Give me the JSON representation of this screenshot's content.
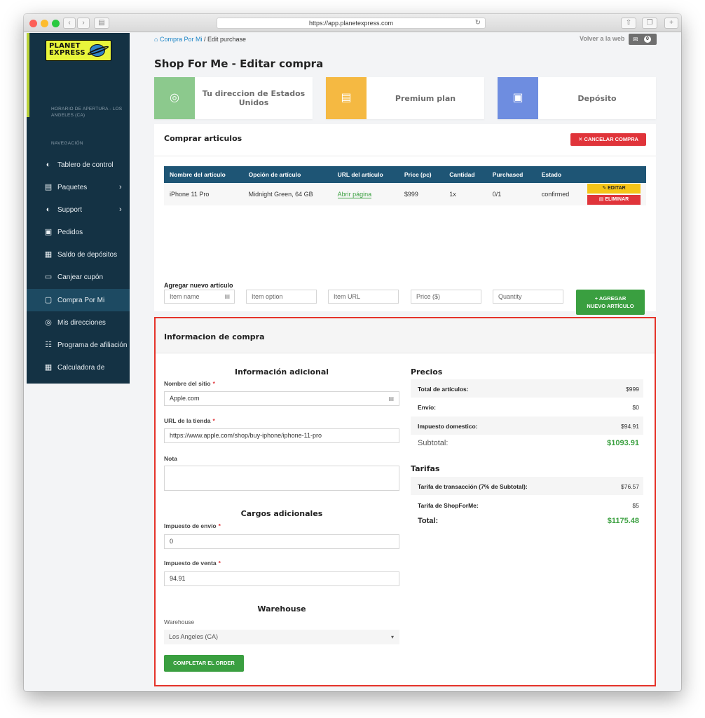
{
  "browser": {
    "url": "https://app.planetexpress.com",
    "reload_icon": "reload-icon"
  },
  "sidebar": {
    "logo_text_1": "PLANET",
    "logo_text_2": "EXPRESS",
    "hours": "HORARIO DE APERTURA - LOS ANGELES (CA)",
    "nav_title": "NAVEGACIÓN",
    "items": [
      {
        "label": "Tablero de control",
        "icon": "gauge-icon",
        "glyph": "◐",
        "chevron": ""
      },
      {
        "label": "Paquetes",
        "icon": "package-icon",
        "glyph": "▤",
        "chevron": "›"
      },
      {
        "label": "Support",
        "icon": "support-icon",
        "glyph": "◐",
        "chevron": "›"
      },
      {
        "label": "Pedidos",
        "icon": "orders-icon",
        "glyph": "▣",
        "chevron": ""
      },
      {
        "label": "Saldo de depósitos",
        "icon": "deposit-icon",
        "glyph": "▦",
        "chevron": ""
      },
      {
        "label": "Canjear cupón",
        "icon": "coupon-icon",
        "glyph": "▭",
        "chevron": ""
      },
      {
        "label": "Compra Por Mi",
        "icon": "shopping-bag-icon",
        "glyph": "▢",
        "chevron": ""
      },
      {
        "label": "Mis direcciones",
        "icon": "location-pin-icon",
        "glyph": "◎",
        "chevron": ""
      },
      {
        "label": "Programa de afiliación",
        "icon": "affiliate-icon",
        "glyph": "☷",
        "chevron": ""
      },
      {
        "label": "Calculadora de",
        "icon": "calculator-icon",
        "glyph": "▦",
        "chevron": ""
      }
    ]
  },
  "header": {
    "breadcrumb_home_icon": "home-icon",
    "breadcrumb_link": "Compra Por Mi",
    "breadcrumb_sep": "/",
    "breadcrumb_current": "Edit purchase",
    "volver": "Volver a la web",
    "notification_count": "0"
  },
  "page_title": "Shop For Me - Editar compra",
  "info_cards": [
    {
      "text": "Tu direccion de Estados Unidos",
      "icon": "location-pin-icon",
      "color": "#8cc98d"
    },
    {
      "text": "Premium plan",
      "icon": "clipboard-icon",
      "color": "#f5b942"
    },
    {
      "text": "Depósito",
      "icon": "dollar-box-icon",
      "color": "#6e8de0"
    }
  ],
  "articles": {
    "title": "Comprar articulos",
    "cancel_button": "CANCELAR COMPRA",
    "columns": [
      "Nombre del artículo",
      "Opción de artículo",
      "URL del artículo",
      "Price (pc)",
      "Cantidad",
      "Purchased",
      "Estado",
      ""
    ],
    "rows": [
      {
        "name": "iPhone 11 Pro",
        "option": "Midnight Green, 64 GB",
        "url": "Abrir página",
        "price": "$999",
        "quantity": "1x",
        "purchased": "0/1",
        "status": "confirmed",
        "edit": "EDITAR",
        "delete": "ELIMINAR"
      }
    ],
    "add_label": "Agregar nuevo artículo",
    "add_placeholders": {
      "name": "Item name",
      "option": "Item option",
      "url": "Item URL",
      "price": "Price ($)",
      "quantity": "Quantity"
    },
    "add_button_line1": "+ AGREGAR",
    "add_button_line2": "NUEVO ARTÍCULO"
  },
  "compra": {
    "title": "Informacion de compra",
    "info_adicional": "Información adicional",
    "site_name_label": "Nombre del sitio",
    "site_name_value": "Apple.com",
    "store_url_label": "URL de la tienda",
    "store_url_value": "https://www.apple.com/shop/buy-iphone/iphone-11-pro",
    "note_label": "Nota",
    "cargos_title": "Cargos adicionales",
    "shipping_tax_label": "Impuesto de envío",
    "shipping_tax_value": "0",
    "sales_tax_label": "Impuesto de venta",
    "sales_tax_value": "94.91",
    "warehouse_title": "Warehouse",
    "warehouse_label": "Warehouse",
    "warehouse_value": "Los Angeles (CA)",
    "complete_button": "COMPLETAR EL ORDER",
    "required_mark": "*"
  },
  "precios": {
    "title": "Precios",
    "rows": [
      {
        "k": "Total de artículos:",
        "v": "$999"
      },
      {
        "k": "Envío:",
        "v": "$0"
      },
      {
        "k": "Impuesto domestico:",
        "v": "$94.91"
      }
    ],
    "subtotal_label": "Subtotal:",
    "subtotal_value": "$1093.91"
  },
  "tarifas": {
    "title": "Tarifas",
    "rows": [
      {
        "k": "Tarifa de transacción (7% de Subtotal):",
        "v": "$76.57"
      },
      {
        "k": "Tarifa de ShopForMe:",
        "v": "$5"
      }
    ],
    "total_label": "Total:",
    "total_value": "$1175.48"
  }
}
